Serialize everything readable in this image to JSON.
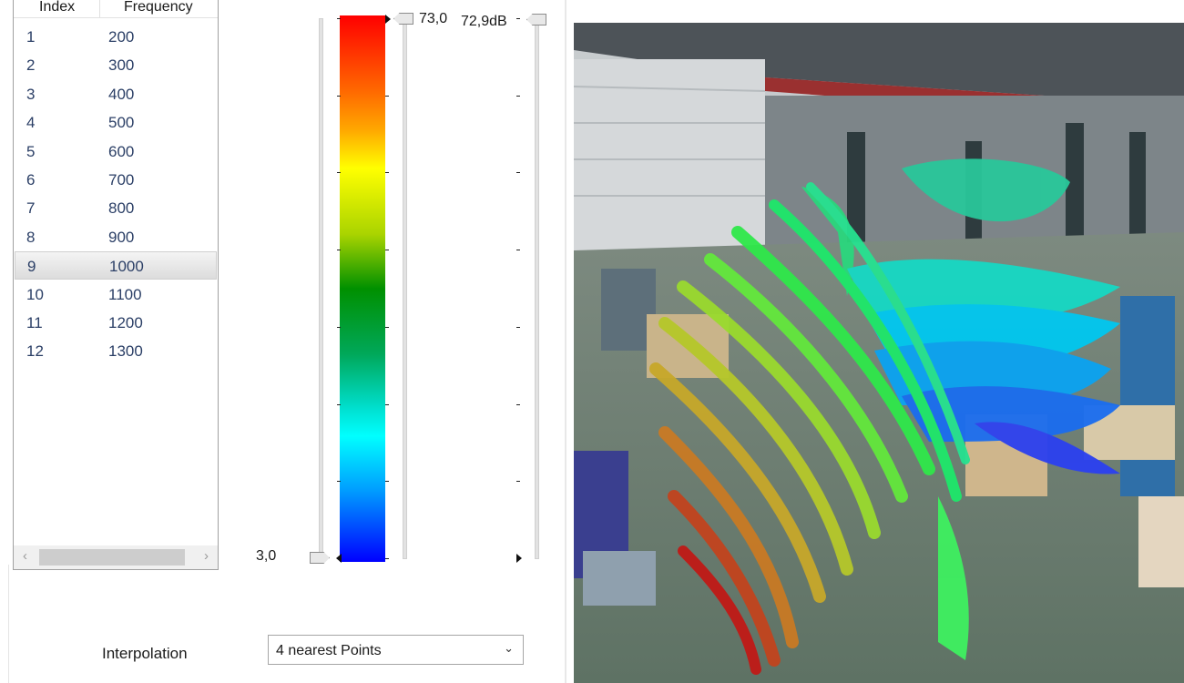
{
  "table": {
    "headers": {
      "index": "Index",
      "frequency": "Frequency"
    },
    "rows": [
      {
        "index": "1",
        "frequency": "200"
      },
      {
        "index": "2",
        "frequency": "300"
      },
      {
        "index": "3",
        "frequency": "400"
      },
      {
        "index": "4",
        "frequency": "500"
      },
      {
        "index": "5",
        "frequency": "600"
      },
      {
        "index": "6",
        "frequency": "700"
      },
      {
        "index": "7",
        "frequency": "800"
      },
      {
        "index": "8",
        "frequency": "900"
      },
      {
        "index": "9",
        "frequency": "1000"
      },
      {
        "index": "10",
        "frequency": "1100"
      },
      {
        "index": "11",
        "frequency": "1200"
      },
      {
        "index": "12",
        "frequency": "1300"
      }
    ],
    "selected_index": "9",
    "scroll_left_icon": "chevron-left-icon",
    "scroll_right_icon": "chevron-right-icon"
  },
  "color_scale": {
    "max_label": "73,0",
    "min_label": "3,0",
    "current_label": "72,9dB",
    "colors": [
      "#ff0000",
      "#ff6a00",
      "#ffa800",
      "#ffff00",
      "#aad400",
      "#009000",
      "#00a85a",
      "#00e0d0",
      "#00ffff",
      "#009cff",
      "#0000ff"
    ]
  },
  "interpolation": {
    "label": "Interpolation",
    "selected": "4 nearest Points",
    "dropdown_icon": "chevron-down-icon"
  },
  "viewport": {
    "description_icon": "factory-hall-3d-acoustic-visualization"
  }
}
